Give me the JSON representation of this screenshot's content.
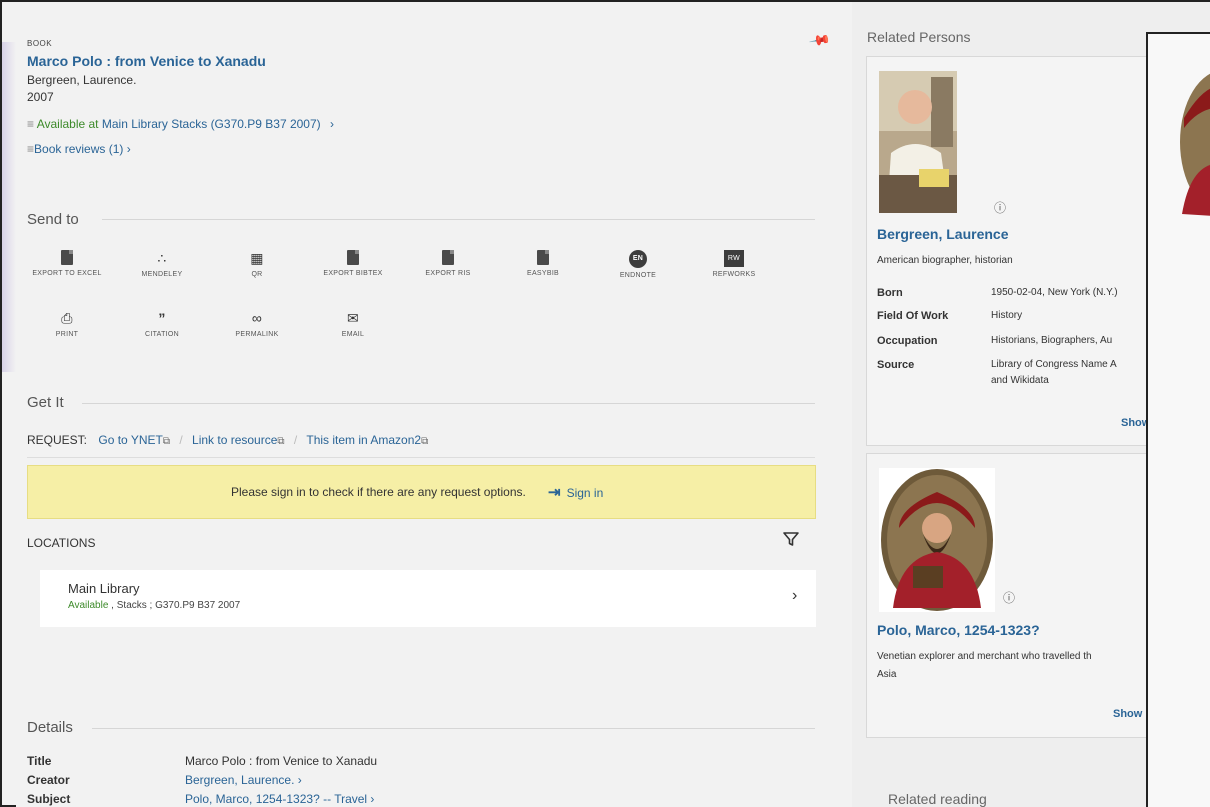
{
  "record": {
    "type": "BOOK",
    "title": "Marco Polo : from Venice to Xanadu",
    "author": "Bergreen, Laurence.",
    "year": "2007",
    "availability": {
      "status": "Available at",
      "location": "Main Library  Stacks (G370.P9 B37 2007)"
    },
    "reviews": "Book reviews (1)"
  },
  "send_to": {
    "heading": "Send to",
    "items": [
      {
        "label": "EXPORT TO EXCEL",
        "icon": "excel-icon"
      },
      {
        "label": "MENDELEY",
        "icon": "mendeley-icon"
      },
      {
        "label": "QR",
        "icon": "qr-icon"
      },
      {
        "label": "EXPORT BIBTEX",
        "icon": "bibtex-icon"
      },
      {
        "label": "EXPORT RIS",
        "icon": "ris-icon"
      },
      {
        "label": "EASYBIB",
        "icon": "easybib-icon"
      },
      {
        "label": "ENDNOTE",
        "icon": "endnote-icon",
        "badge": "EN"
      },
      {
        "label": "REFWORKS",
        "icon": "refworks-icon",
        "badge": "RW"
      },
      {
        "label": "PRINT",
        "icon": "print-icon"
      },
      {
        "label": "CITATION",
        "icon": "citation-icon"
      },
      {
        "label": "PERMALINK",
        "icon": "permalink-icon"
      },
      {
        "label": "EMAIL",
        "icon": "email-icon"
      }
    ]
  },
  "get_it": {
    "heading": "Get It",
    "request_label": "REQUEST:",
    "links": [
      "Go to YNET",
      "Link to resource",
      "This item in Amazon2"
    ],
    "signin_message": "Please sign in to check if there are any request options.",
    "signin_button": "Sign in",
    "locations_label": "LOCATIONS",
    "location": {
      "name": "Main Library",
      "status": "Available",
      "detail": " , Stacks ; G370.P9 B37 2007"
    }
  },
  "details": {
    "heading": "Details",
    "rows": [
      {
        "key": "Title",
        "value": "Marco Polo : from Venice to Xanadu"
      },
      {
        "key": "Creator",
        "value": "Bergreen, Laurence."
      },
      {
        "key": "Subject",
        "value": "Polo, Marco, 1254-1323? -- Travel"
      }
    ]
  },
  "related_persons": {
    "heading": "Related Persons",
    "persons": [
      {
        "name": "Bergreen, Laurence",
        "description": "American biographer, historian",
        "facts": [
          {
            "key": "Born",
            "value": "1950-02-04, New York (N.Y.)"
          },
          {
            "key": "Field Of Work",
            "value": "History"
          },
          {
            "key": "Occupation",
            "value": "Historians, Biographers, Au"
          },
          {
            "key": "Source",
            "value": "Library of Congress Name A"
          }
        ],
        "source_extra": "and Wikidata",
        "show": "Show"
      },
      {
        "name": "Polo, Marco, 1254-1323?",
        "description_line1": "Venetian explorer and merchant who travelled th",
        "description_line2": "Asia",
        "show": "Show"
      }
    ]
  },
  "related_reading": "Related reading",
  "colors": {
    "link": "#2a6496",
    "available": "#3d8a2a",
    "signin_banner": "#f6efa6",
    "page_bg": "#f2f2f2"
  }
}
